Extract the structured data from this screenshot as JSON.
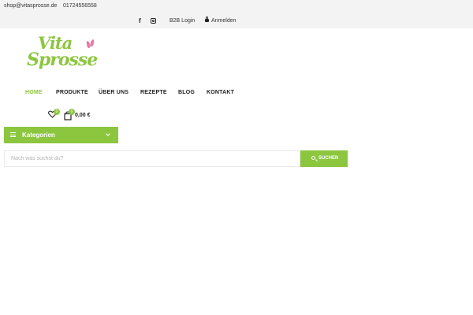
{
  "topbar": {
    "email": "shop@vitasprosse.de",
    "phone": "01724556558",
    "facebook_icon": "f",
    "b2b_login": "B2B Login",
    "login": "Anmelden"
  },
  "logo": {
    "line1": "Vita",
    "line2": "Sprosse",
    "brand_green": "#8cc63f",
    "accent_pink": "#e87ba7"
  },
  "nav": {
    "items": [
      {
        "label": "HOME",
        "active": true
      },
      {
        "label": "PRODUKTE",
        "active": false
      },
      {
        "label": "ÜBER UNS",
        "active": false
      },
      {
        "label": "REZEPTE",
        "active": false
      },
      {
        "label": "BLOG",
        "active": false
      },
      {
        "label": "KONTAKT",
        "active": false
      }
    ]
  },
  "header_icons": {
    "wishlist_count": "0",
    "cart_count": "0",
    "cart_total": "0,00 €"
  },
  "categories": {
    "label": "Kategorien"
  },
  "search": {
    "placeholder": "Nach was suchst du?",
    "button_label": "SUCHEN"
  },
  "colors": {
    "accent": "#8cc63f",
    "topbar_bg": "#f3f3f3"
  }
}
